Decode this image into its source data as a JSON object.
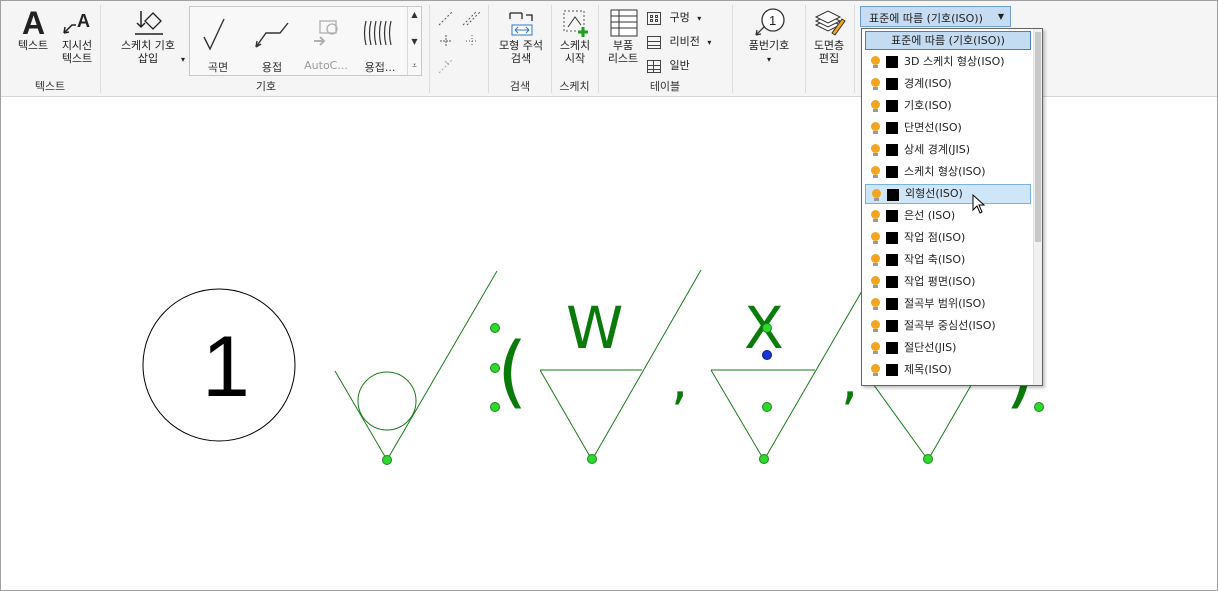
{
  "ribbon": {
    "text_panel": {
      "title": "텍스트",
      "text_btn": "텍스트",
      "leader_l1": "지시선",
      "leader_l2": "텍스트"
    },
    "symbol_panel": {
      "title": "기호",
      "sketch_l1": "스케치 기호",
      "sketch_l2": "삽입",
      "gallery": [
        "곡면",
        "용접",
        "AutoC...",
        "용접..."
      ]
    },
    "search_panel": {
      "title": "검색",
      "l1": "모형 주석",
      "l2": "검색"
    },
    "sketch_panel": {
      "title": "스케치",
      "l1": "스케치",
      "l2": "시작"
    },
    "table_panel": {
      "title": "테이블",
      "partslist_l1": "부품",
      "partslist_l2": "리스트",
      "hole": "구멍",
      "revision": "리비전",
      "general": "일반"
    },
    "balloon": {
      "label": "품번기호"
    },
    "layers": {
      "l1": "도면층",
      "l2": "편집"
    },
    "combo_value": "표준에 따름 (기호(ISO))"
  },
  "layer_dropdown": {
    "selected": "표준에 따름 (기호(ISO))",
    "items": [
      "3D 스케치 형상(ISO)",
      "경계(ISO)",
      "기호(ISO)",
      "단면선(ISO)",
      "상세 경계(JIS)",
      "스케치 형상(ISO)",
      "외형선(ISO)",
      "은선 (ISO)",
      "작업 점(ISO)",
      "작업 축(ISO)",
      "작업 평면(ISO)",
      "절곡부 범위(ISO)",
      "절곡부 중심선(ISO)",
      "절단선(JIS)",
      "제목(ISO)"
    ],
    "hovered_index": 6
  },
  "canvas": {
    "balloon_number": "1",
    "open_paren": "(",
    "close_paren": ")",
    "comma1": ",",
    "comma2": ",",
    "letter_w": "W",
    "letter_x": "X"
  },
  "colors": {
    "accent": "#c5dcf2",
    "grip": "#2ed82e",
    "symbol_green": "#0a7a0a"
  }
}
